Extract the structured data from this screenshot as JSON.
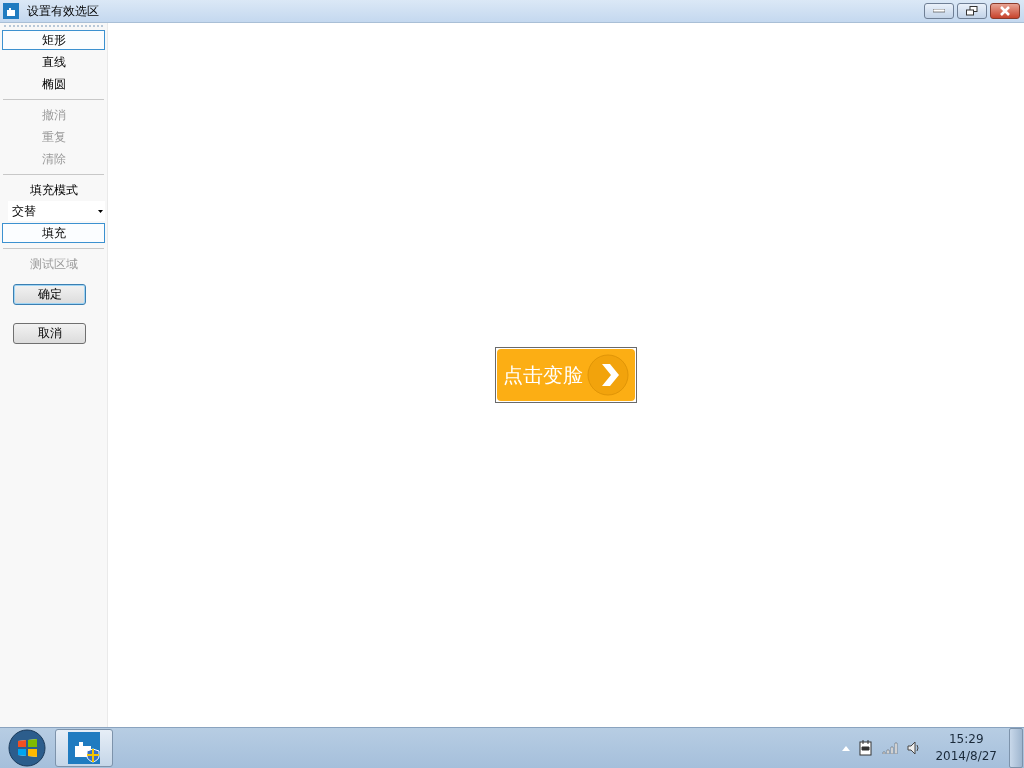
{
  "window": {
    "title": "设置有效选区"
  },
  "sidebar": {
    "groups": [
      {
        "items": [
          {
            "kind": "tool",
            "label": "矩形",
            "selected": true,
            "disabled": false
          },
          {
            "kind": "tool",
            "label": "直线",
            "selected": false,
            "disabled": false
          },
          {
            "kind": "tool",
            "label": "椭圆",
            "selected": false,
            "disabled": false
          }
        ]
      },
      {
        "items": [
          {
            "kind": "tool",
            "label": "撤消",
            "selected": false,
            "disabled": true
          },
          {
            "kind": "tool",
            "label": "重复",
            "selected": false,
            "disabled": true
          },
          {
            "kind": "tool",
            "label": "清除",
            "selected": false,
            "disabled": true
          }
        ]
      },
      {
        "items": [
          {
            "kind": "label",
            "label": "填充模式",
            "disabled": false
          },
          {
            "kind": "dropdown",
            "value": "交替"
          },
          {
            "kind": "tool",
            "label": "填充",
            "selected": true,
            "disabled": false
          }
        ]
      },
      {
        "items": [
          {
            "kind": "label",
            "label": "测试区域",
            "disabled": true
          },
          {
            "kind": "button",
            "label": "确定",
            "default": true
          },
          {
            "kind": "button",
            "label": "取消",
            "default": false
          }
        ]
      }
    ]
  },
  "canvas": {
    "button": {
      "label": "点击变脸"
    }
  },
  "taskbar": {
    "clock": {
      "time": "15:29",
      "date": "2014/8/27"
    }
  }
}
